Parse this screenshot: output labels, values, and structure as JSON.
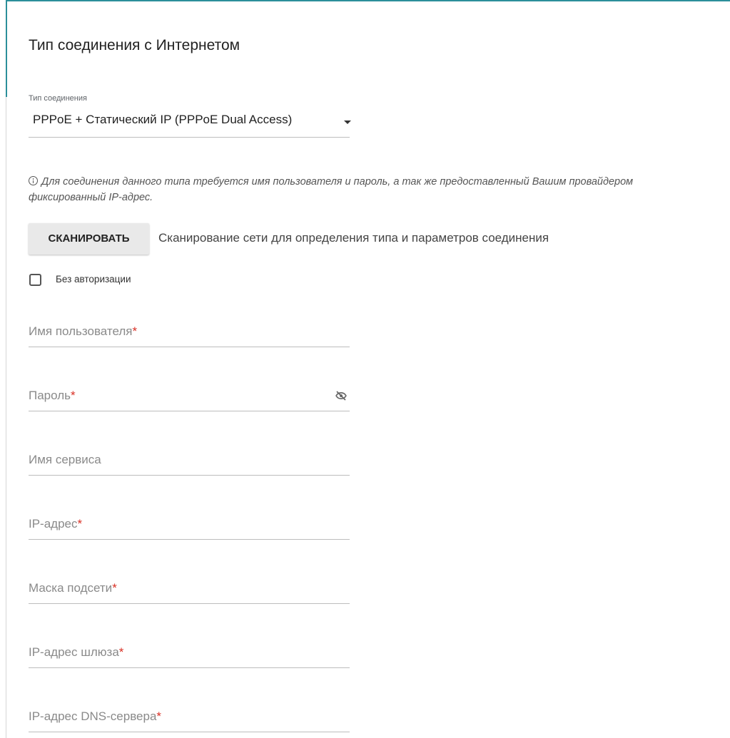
{
  "page": {
    "title": "Тип соединения с Интернетом"
  },
  "connection_type": {
    "label": "Тип соединения",
    "value": "PPPoE + Статический IP (PPPoE Dual Access)"
  },
  "info": {
    "text": "Для соединения данного типа требуется имя пользователя и пароль, а так же предоставленный Вашим провайдером фиксированный IP-адрес."
  },
  "scan": {
    "button_label": "СКАНИРОВАТЬ",
    "description": "Сканирование сети для определения типа и параметров соединения"
  },
  "no_auth": {
    "label": "Без авторизации",
    "checked": false
  },
  "fields": {
    "username": "Имя пользователя",
    "password": "Пароль",
    "service_name": "Имя сервиса",
    "ip_address": "IP-адрес",
    "subnet_mask": "Маска подсети",
    "gateway": "IP-адрес шлюза",
    "dns": "IP-адрес DNS-сервера",
    "required_mark": "*"
  },
  "colors": {
    "accent": "#2b8f9a",
    "required": "#d93025"
  },
  "icons": {
    "info": "info-circle-icon",
    "password_visibility": "eye-off-icon",
    "select_caret": "caret-down-icon"
  }
}
